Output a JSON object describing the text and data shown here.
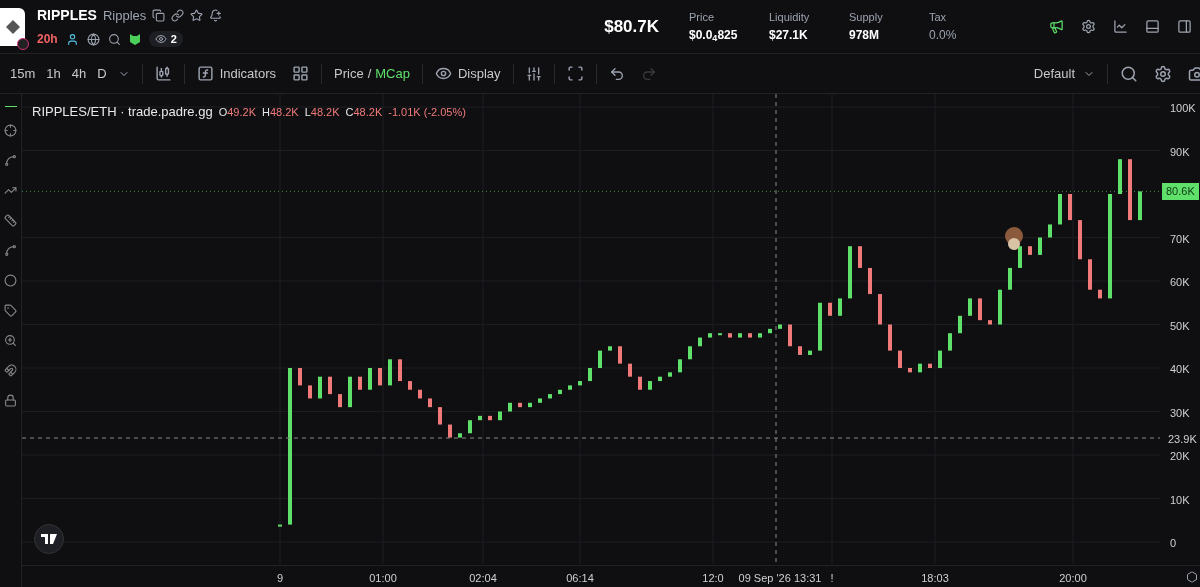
{
  "token": {
    "symbol": "RIPPLES",
    "name": "Ripples",
    "age": "20h",
    "watchers": "2"
  },
  "market_cap": "$80.7K",
  "stats": [
    {
      "label": "Price",
      "value": "$0.0$_{4}$825",
      "muted": false
    },
    {
      "label": "Liquidity",
      "value": "$27.1K",
      "muted": false
    },
    {
      "label": "Supply",
      "value": "978M",
      "muted": false
    },
    {
      "label": "Tax",
      "value": "0.0%",
      "muted": true
    }
  ],
  "toolbar": {
    "timeframes": [
      "15m",
      "1h",
      "4h",
      "D"
    ],
    "indicators": "Indicators",
    "price_modes": [
      {
        "label": "Price",
        "selected": false
      },
      {
        "label": "MCap",
        "selected": true
      }
    ],
    "mode_separator": "/",
    "display": "Display",
    "undo": {
      "disabled": false
    },
    "redo": {
      "disabled": true
    },
    "layout": "Default"
  },
  "legend": {
    "pair": "RIPPLES/ETH · trade.padre.gg",
    "ohlc": [
      {
        "key": "O",
        "value": "49.2K"
      },
      {
        "key": "H",
        "value": "48.2K"
      },
      {
        "key": "L",
        "value": "48.2K"
      },
      {
        "key": "C",
        "value": "48.2K"
      }
    ],
    "change": "-1.01K (-2.05%)"
  },
  "crosshair": {
    "x_label": "09 Sep '26  13:31",
    "y_label": "23.9K"
  },
  "last_price": "80.6K",
  "price_axis": [
    "100K",
    "90K",
    "70K",
    "60K",
    "50K",
    "40K",
    "30K",
    "20K",
    "10K",
    "0"
  ],
  "time_axis": [
    "9",
    "01:00",
    "02:04",
    "06:14",
    "12:0",
    "!",
    "18:03",
    "20:00"
  ]
}
